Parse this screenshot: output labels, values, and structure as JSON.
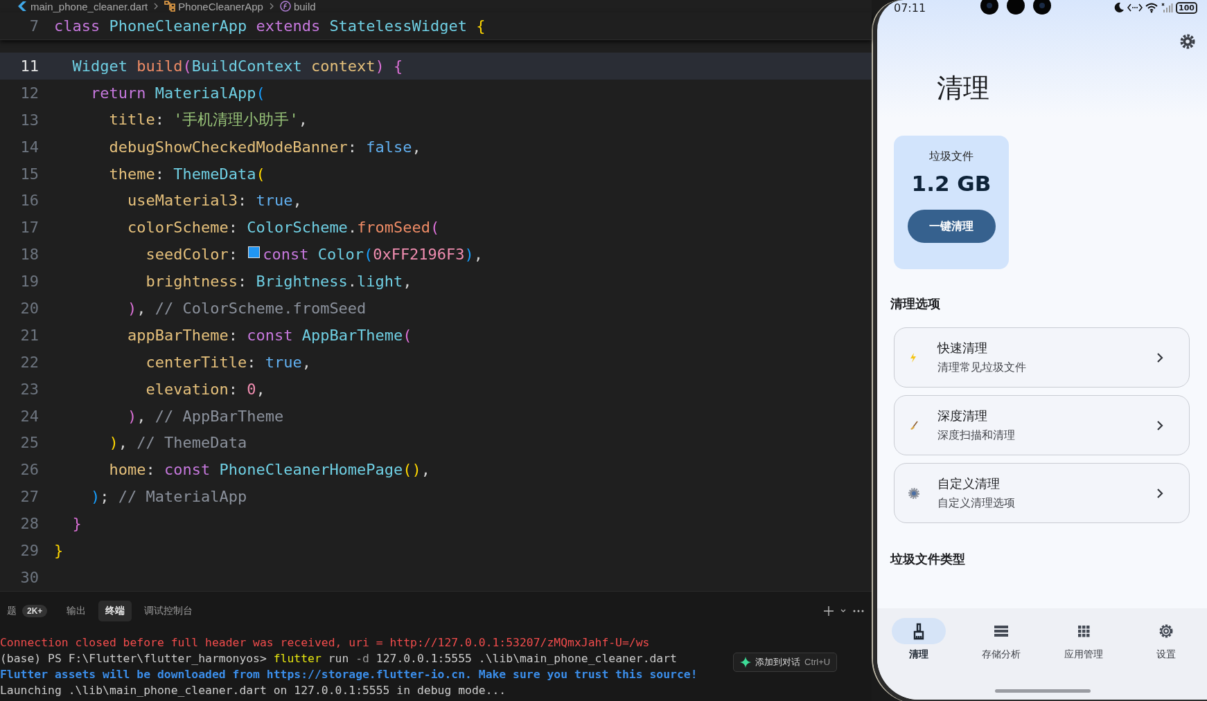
{
  "breadcrumb": [
    {
      "label": "main_phone_cleaner.dart"
    },
    {
      "label": "PhoneCleanerApp"
    },
    {
      "label": "build"
    }
  ],
  "editor": {
    "sticky_line": {
      "number": "7",
      "tokens": [
        {
          "t": "class ",
          "kind": "kw"
        },
        {
          "t": "PhoneCleanerApp ",
          "kind": "type"
        },
        {
          "t": "extends ",
          "kind": "kw"
        },
        {
          "t": "StatelessWidget ",
          "kind": "type"
        },
        {
          "t": "{",
          "kind": "b1"
        }
      ]
    },
    "lines": [
      {
        "number": "11",
        "current": true,
        "tokens": [
          {
            "t": "  Widget ",
            "kind": "type"
          },
          {
            "t": "build",
            "kind": "fn"
          },
          {
            "t": "(",
            "kind": "b2"
          },
          {
            "t": "BuildContext ",
            "kind": "type"
          },
          {
            "t": "context",
            "kind": "param"
          },
          {
            "t": ")",
            "kind": "b2"
          },
          {
            "t": " {",
            "kind": "b2"
          }
        ]
      },
      {
        "number": "12",
        "current": false,
        "tokens": [
          {
            "t": "    return ",
            "kind": "kw"
          },
          {
            "t": "MaterialApp",
            "kind": "type"
          },
          {
            "t": "(",
            "kind": "b3"
          }
        ]
      },
      {
        "number": "13",
        "current": false,
        "tokens": [
          {
            "t": "      title",
            "kind": "param"
          },
          {
            "t": ": ",
            "kind": "punct"
          },
          {
            "t": "'手机清理小助手'",
            "kind": "str"
          },
          {
            "t": ",",
            "kind": "punct"
          }
        ]
      },
      {
        "number": "14",
        "current": false,
        "tokens": [
          {
            "t": "      debugShowCheckedModeBanner",
            "kind": "param"
          },
          {
            "t": ": ",
            "kind": "punct"
          },
          {
            "t": "false",
            "kind": "bool"
          },
          {
            "t": ",",
            "kind": "punct"
          }
        ]
      },
      {
        "number": "15",
        "current": false,
        "tokens": [
          {
            "t": "      theme",
            "kind": "param"
          },
          {
            "t": ": ",
            "kind": "punct"
          },
          {
            "t": "ThemeData",
            "kind": "type"
          },
          {
            "t": "(",
            "kind": "b1"
          }
        ]
      },
      {
        "number": "16",
        "current": false,
        "tokens": [
          {
            "t": "        useMaterial3",
            "kind": "param"
          },
          {
            "t": ": ",
            "kind": "punct"
          },
          {
            "t": "true",
            "kind": "bool"
          },
          {
            "t": ",",
            "kind": "punct"
          }
        ]
      },
      {
        "number": "17",
        "current": false,
        "tokens": [
          {
            "t": "        colorScheme",
            "kind": "param"
          },
          {
            "t": ": ",
            "kind": "punct"
          },
          {
            "t": "ColorScheme",
            "kind": "type"
          },
          {
            "t": ".",
            "kind": "punct"
          },
          {
            "t": "fromSeed",
            "kind": "fn"
          },
          {
            "t": "(",
            "kind": "b2"
          }
        ]
      },
      {
        "number": "18",
        "current": false,
        "tokens": [
          {
            "t": "          seedColor",
            "kind": "param"
          },
          {
            "t": ": ",
            "kind": "punct"
          },
          {
            "kind": "swatch",
            "color": "#2196f3"
          },
          {
            "t": "const ",
            "kind": "kw"
          },
          {
            "t": "Color",
            "kind": "type"
          },
          {
            "t": "(",
            "kind": "b3"
          },
          {
            "t": "0xFF2196F3",
            "kind": "num"
          },
          {
            "t": ")",
            "kind": "b3"
          },
          {
            "t": ",",
            "kind": "punct"
          }
        ]
      },
      {
        "number": "19",
        "current": false,
        "tokens": [
          {
            "t": "          brightness",
            "kind": "param"
          },
          {
            "t": ": ",
            "kind": "punct"
          },
          {
            "t": "Brightness",
            "kind": "type"
          },
          {
            "t": ".",
            "kind": "punct"
          },
          {
            "t": "light",
            "kind": "type"
          },
          {
            "t": ",",
            "kind": "punct"
          }
        ]
      },
      {
        "number": "20",
        "current": false,
        "tokens": [
          {
            "t": "        )",
            "kind": "b2"
          },
          {
            "t": ", ",
            "kind": "punct"
          },
          {
            "t": "// ColorScheme.fromSeed",
            "kind": "comment"
          }
        ]
      },
      {
        "number": "21",
        "current": false,
        "tokens": [
          {
            "t": "        appBarTheme",
            "kind": "param"
          },
          {
            "t": ": ",
            "kind": "punct"
          },
          {
            "t": "const ",
            "kind": "kw"
          },
          {
            "t": "AppBarTheme",
            "kind": "type"
          },
          {
            "t": "(",
            "kind": "b2"
          }
        ]
      },
      {
        "number": "22",
        "current": false,
        "tokens": [
          {
            "t": "          centerTitle",
            "kind": "param"
          },
          {
            "t": ": ",
            "kind": "punct"
          },
          {
            "t": "true",
            "kind": "bool"
          },
          {
            "t": ",",
            "kind": "punct"
          }
        ]
      },
      {
        "number": "23",
        "current": false,
        "tokens": [
          {
            "t": "          elevation",
            "kind": "param"
          },
          {
            "t": ": ",
            "kind": "punct"
          },
          {
            "t": "0",
            "kind": "num"
          },
          {
            "t": ",",
            "kind": "punct"
          }
        ]
      },
      {
        "number": "24",
        "current": false,
        "tokens": [
          {
            "t": "        )",
            "kind": "b2"
          },
          {
            "t": ", ",
            "kind": "punct"
          },
          {
            "t": "// AppBarTheme",
            "kind": "comment"
          }
        ]
      },
      {
        "number": "25",
        "current": false,
        "tokens": [
          {
            "t": "      )",
            "kind": "b1"
          },
          {
            "t": ", ",
            "kind": "punct"
          },
          {
            "t": "// ThemeData",
            "kind": "comment"
          }
        ]
      },
      {
        "number": "26",
        "current": false,
        "tokens": [
          {
            "t": "      home",
            "kind": "param"
          },
          {
            "t": ": ",
            "kind": "punct"
          },
          {
            "t": "const ",
            "kind": "kw"
          },
          {
            "t": "PhoneCleanerHomePage",
            "kind": "type"
          },
          {
            "t": "()",
            "kind": "b1"
          },
          {
            "t": ",",
            "kind": "punct"
          }
        ]
      },
      {
        "number": "27",
        "current": false,
        "tokens": [
          {
            "t": "    )",
            "kind": "b3"
          },
          {
            "t": "; ",
            "kind": "punct"
          },
          {
            "t": "// MaterialApp",
            "kind": "comment"
          }
        ]
      },
      {
        "number": "28",
        "current": false,
        "tokens": [
          {
            "t": "  }",
            "kind": "b2"
          }
        ]
      },
      {
        "number": "29",
        "current": false,
        "tokens": [
          {
            "t": "}",
            "kind": "b1"
          }
        ]
      },
      {
        "number": "30",
        "current": false
      }
    ]
  },
  "panel": {
    "tabs": [
      {
        "label": "题",
        "badge": "2K+",
        "selected": false
      },
      {
        "label": "输出",
        "selected": false
      },
      {
        "label": "终端",
        "selected": true
      },
      {
        "label": "调试控制台",
        "selected": false
      }
    ],
    "terminal": [
      {
        "tokens": [
          {
            "t": "Connection closed before full header was received, uri = http://127.0.0.1:53207/zMQmxJahf-U=/ws",
            "kind": "error"
          }
        ]
      },
      {
        "tokens": [
          {
            "t": "(base) PS F:\\Flutter\\flutter_harmonyos> ",
            "kind": "plain"
          },
          {
            "t": "flutter",
            "kind": "cmd"
          },
          {
            "t": " run ",
            "kind": "plain"
          },
          {
            "t": "-d",
            "kind": "flag"
          },
          {
            "t": " 127.0.0.1:5555 .\\lib\\main_phone_cleaner.dart",
            "kind": "plain"
          }
        ]
      },
      {
        "tokens": [
          {
            "t": "Flutter assets will be downloaded from https://storage.flutter-io.cn. Make sure you trust this source!",
            "kind": "info"
          }
        ]
      },
      {
        "tokens": [
          {
            "t": "Launching .\\lib\\main_phone_cleaner.dart on 127.0.0.1:5555 in debug mode...",
            "kind": "plain"
          }
        ]
      }
    ],
    "chat_button": {
      "label": "添加到对话",
      "shortcut": "Ctrl+U"
    }
  },
  "phone": {
    "status_bar": {
      "time": "07:11",
      "battery": "100"
    },
    "title": "清理",
    "summary": {
      "label": "垃圾文件",
      "value": "1.2 GB",
      "button": "一键清理"
    },
    "options_heading": "清理选项",
    "options": [
      {
        "title": "快速清理",
        "subtitle": "清理常见垃圾文件"
      },
      {
        "title": "深度清理",
        "subtitle": "深度扫描和清理"
      },
      {
        "title": "自定义清理",
        "subtitle": "自定义清理选项"
      }
    ],
    "types_heading": "垃圾文件类型",
    "nav": [
      {
        "label": "清理",
        "selected": true
      },
      {
        "label": "存储分析",
        "selected": false
      },
      {
        "label": "应用管理",
        "selected": false
      },
      {
        "label": "设置",
        "selected": false
      }
    ]
  }
}
